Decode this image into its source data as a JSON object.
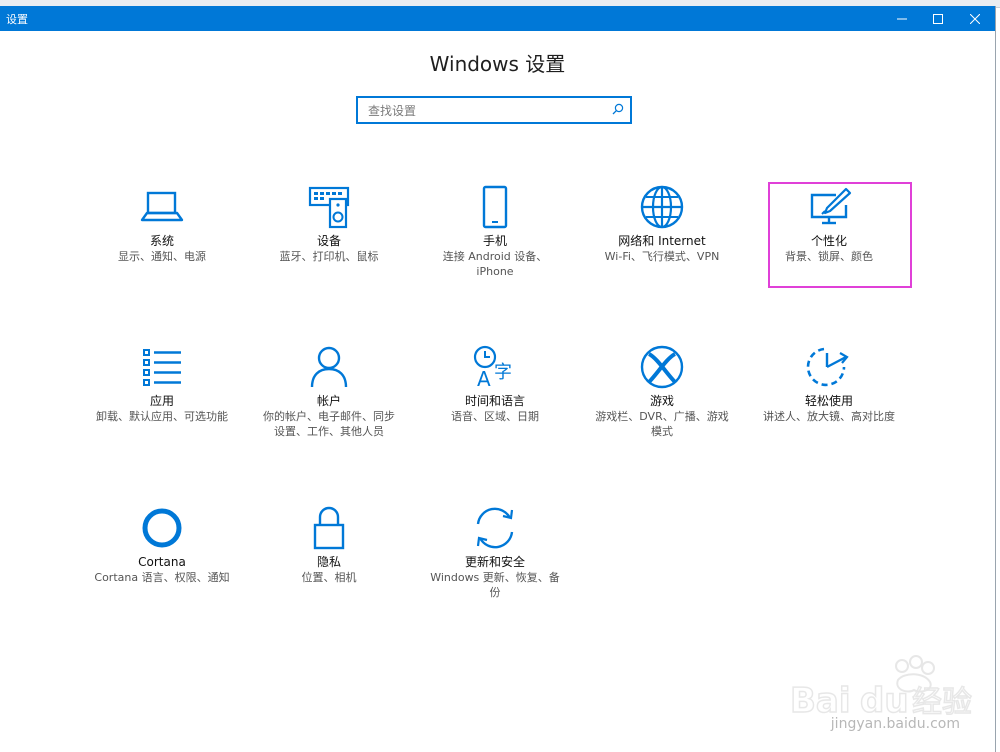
{
  "window": {
    "title": "设置",
    "heading": "Windows 设置"
  },
  "search": {
    "placeholder": "查找设置"
  },
  "tiles": [
    {
      "name": "系统",
      "desc": "显示、通知、电源",
      "icon": "laptop-icon"
    },
    {
      "name": "设备",
      "desc": "蓝牙、打印机、鼠标",
      "icon": "devices-icon"
    },
    {
      "name": "手机",
      "desc": "连接 Android 设备、iPhone",
      "icon": "phone-icon"
    },
    {
      "name": "网络和 Internet",
      "desc": "Wi-Fi、飞行模式、VPN",
      "icon": "globe-icon"
    },
    {
      "name": "个性化",
      "desc": "背景、锁屏、颜色",
      "icon": "personalization-icon"
    },
    {
      "name": "应用",
      "desc": "卸载、默认应用、可选功能",
      "icon": "apps-list-icon"
    },
    {
      "name": "帐户",
      "desc": "你的帐户、电子邮件、同步设置、工作、其他人员",
      "icon": "person-icon"
    },
    {
      "name": "时间和语言",
      "desc": "语音、区域、日期",
      "icon": "time-language-icon"
    },
    {
      "name": "游戏",
      "desc": "游戏栏、DVR、广播、游戏模式",
      "icon": "xbox-icon"
    },
    {
      "name": "轻松使用",
      "desc": "讲述人、放大镜、高对比度",
      "icon": "ease-of-access-icon"
    },
    {
      "name": "Cortana",
      "desc": "Cortana 语言、权限、通知",
      "icon": "cortana-ring-icon"
    },
    {
      "name": "隐私",
      "desc": "位置、相机",
      "icon": "lock-icon"
    },
    {
      "name": "更新和安全",
      "desc": "Windows 更新、恢复、备份",
      "icon": "sync-arrows-icon"
    }
  ],
  "watermark": {
    "logo": "Baidu经验",
    "url": "jingyan.baidu.com"
  },
  "colors": {
    "accent": "#0078d7",
    "highlight": "#e040d8"
  }
}
